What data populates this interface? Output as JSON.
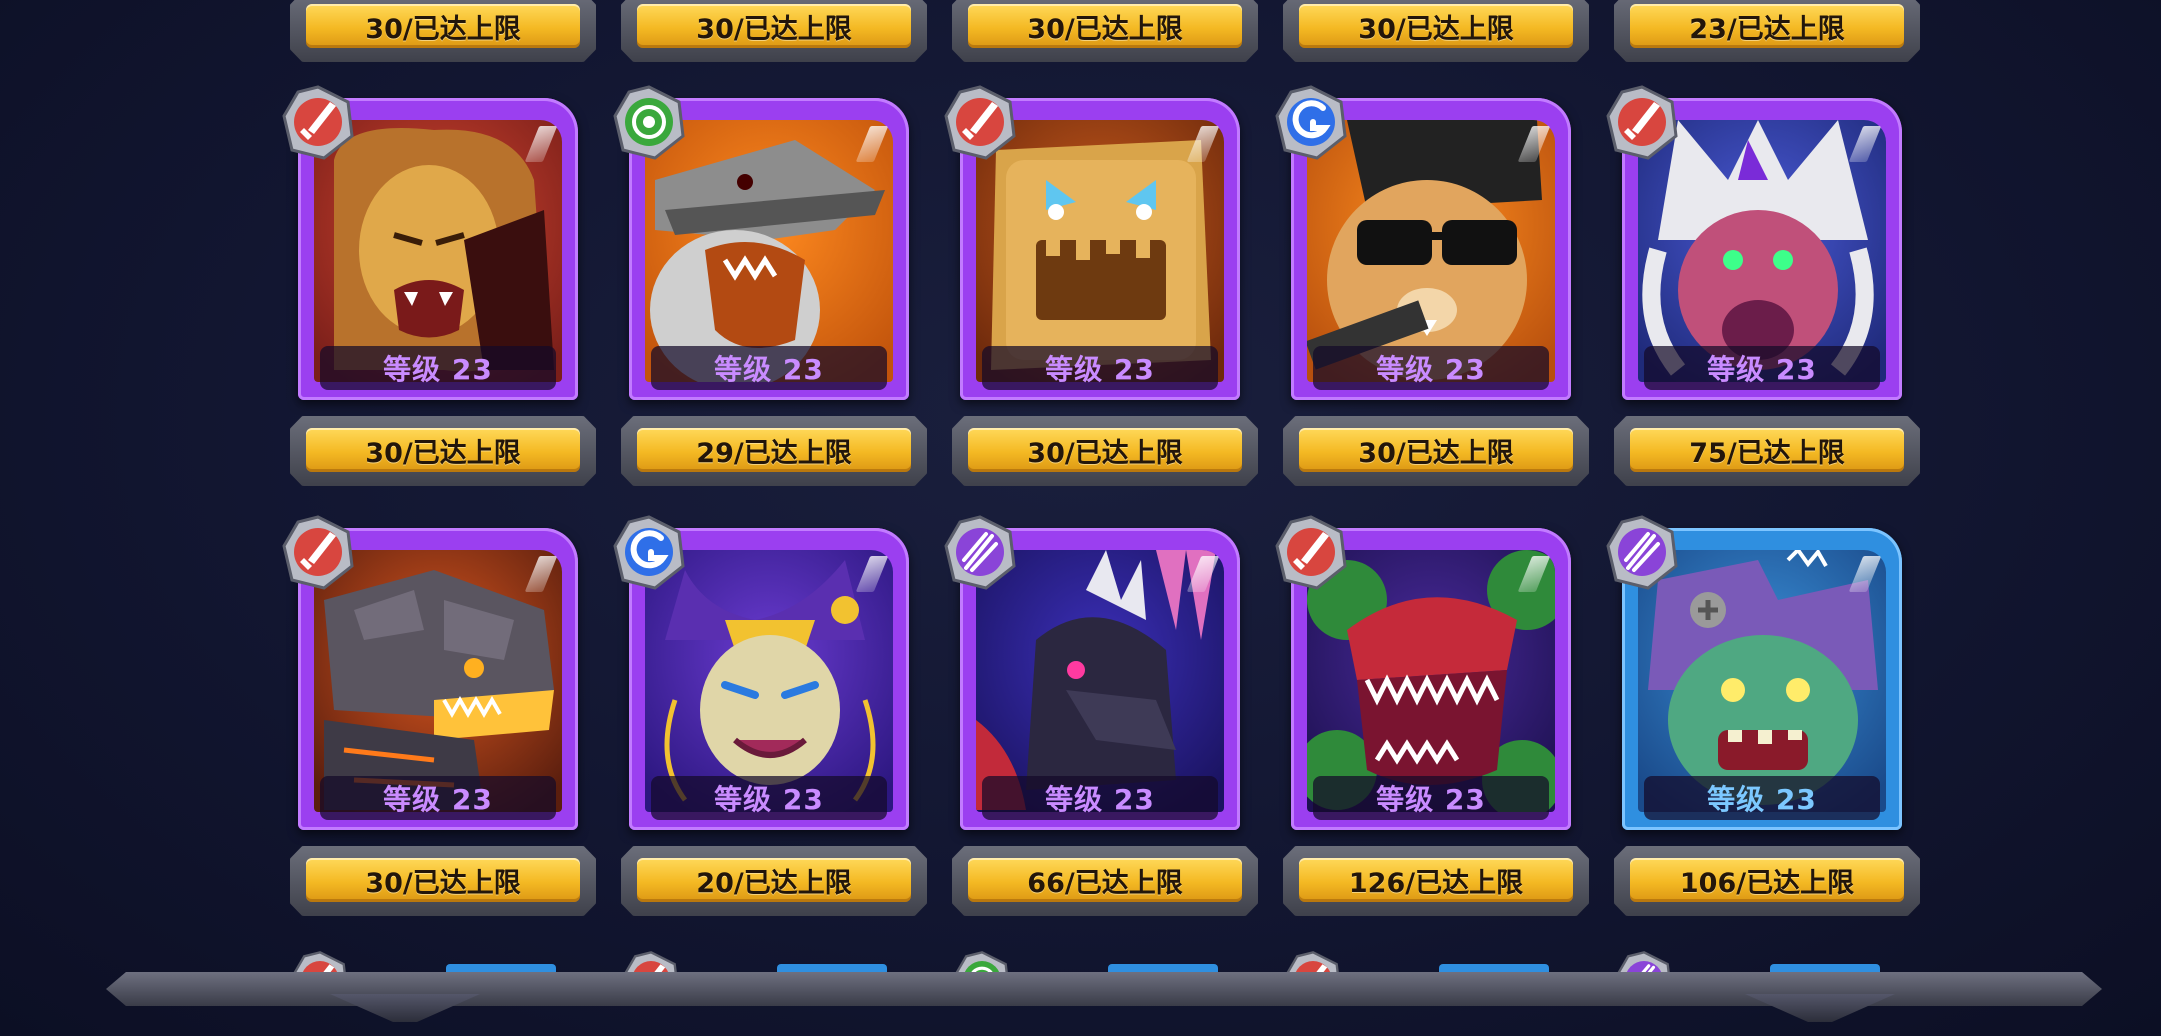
{
  "top_row_pills": [
    "30/已达上限",
    "30/已达上限",
    "30/已达上限",
    "30/已达上限",
    "23/已达上限"
  ],
  "cards": [
    {
      "level": "等级 23",
      "count": "30/已达上限",
      "class_icon": "sword-icon",
      "frame": "purple",
      "art": "lion"
    },
    {
      "level": "等级 23",
      "count": "29/已达上限",
      "class_icon": "target-icon",
      "frame": "purple",
      "art": "crocodile"
    },
    {
      "level": "等级 23",
      "count": "30/已达上限",
      "class_icon": "sword-icon",
      "frame": "purple",
      "art": "golem"
    },
    {
      "level": "等级 23",
      "count": "30/已达上限",
      "class_icon": "shield-g-icon",
      "frame": "purple",
      "art": "hamster"
    },
    {
      "level": "等级 23",
      "count": "75/已达上限",
      "class_icon": "sword-icon",
      "frame": "purple",
      "art": "shaman"
    },
    {
      "level": "等级 23",
      "count": "30/已达上限",
      "class_icon": "sword-icon",
      "frame": "purple",
      "art": "rockcroc"
    },
    {
      "level": "等级 23",
      "count": "20/已达上限",
      "class_icon": "shield-g-icon",
      "frame": "purple",
      "art": "jester"
    },
    {
      "level": "等级 23",
      "count": "66/已达上限",
      "class_icon": "magic-icon",
      "frame": "purple",
      "art": "raven"
    },
    {
      "level": "等级 23",
      "count": "126/已达上限",
      "class_icon": "sword-icon",
      "frame": "purple",
      "art": "plant"
    },
    {
      "level": "等级 23",
      "count": "106/已达上限",
      "class_icon": "magic-icon",
      "frame": "blue",
      "art": "zombie"
    }
  ],
  "colors": {
    "rarity_purple": "#9b3ff0",
    "rarity_blue": "#2f8fe0",
    "pill_gold": "#f4b923",
    "level_text_purple": "#c98bff",
    "level_text_blue": "#7cc8ff"
  }
}
